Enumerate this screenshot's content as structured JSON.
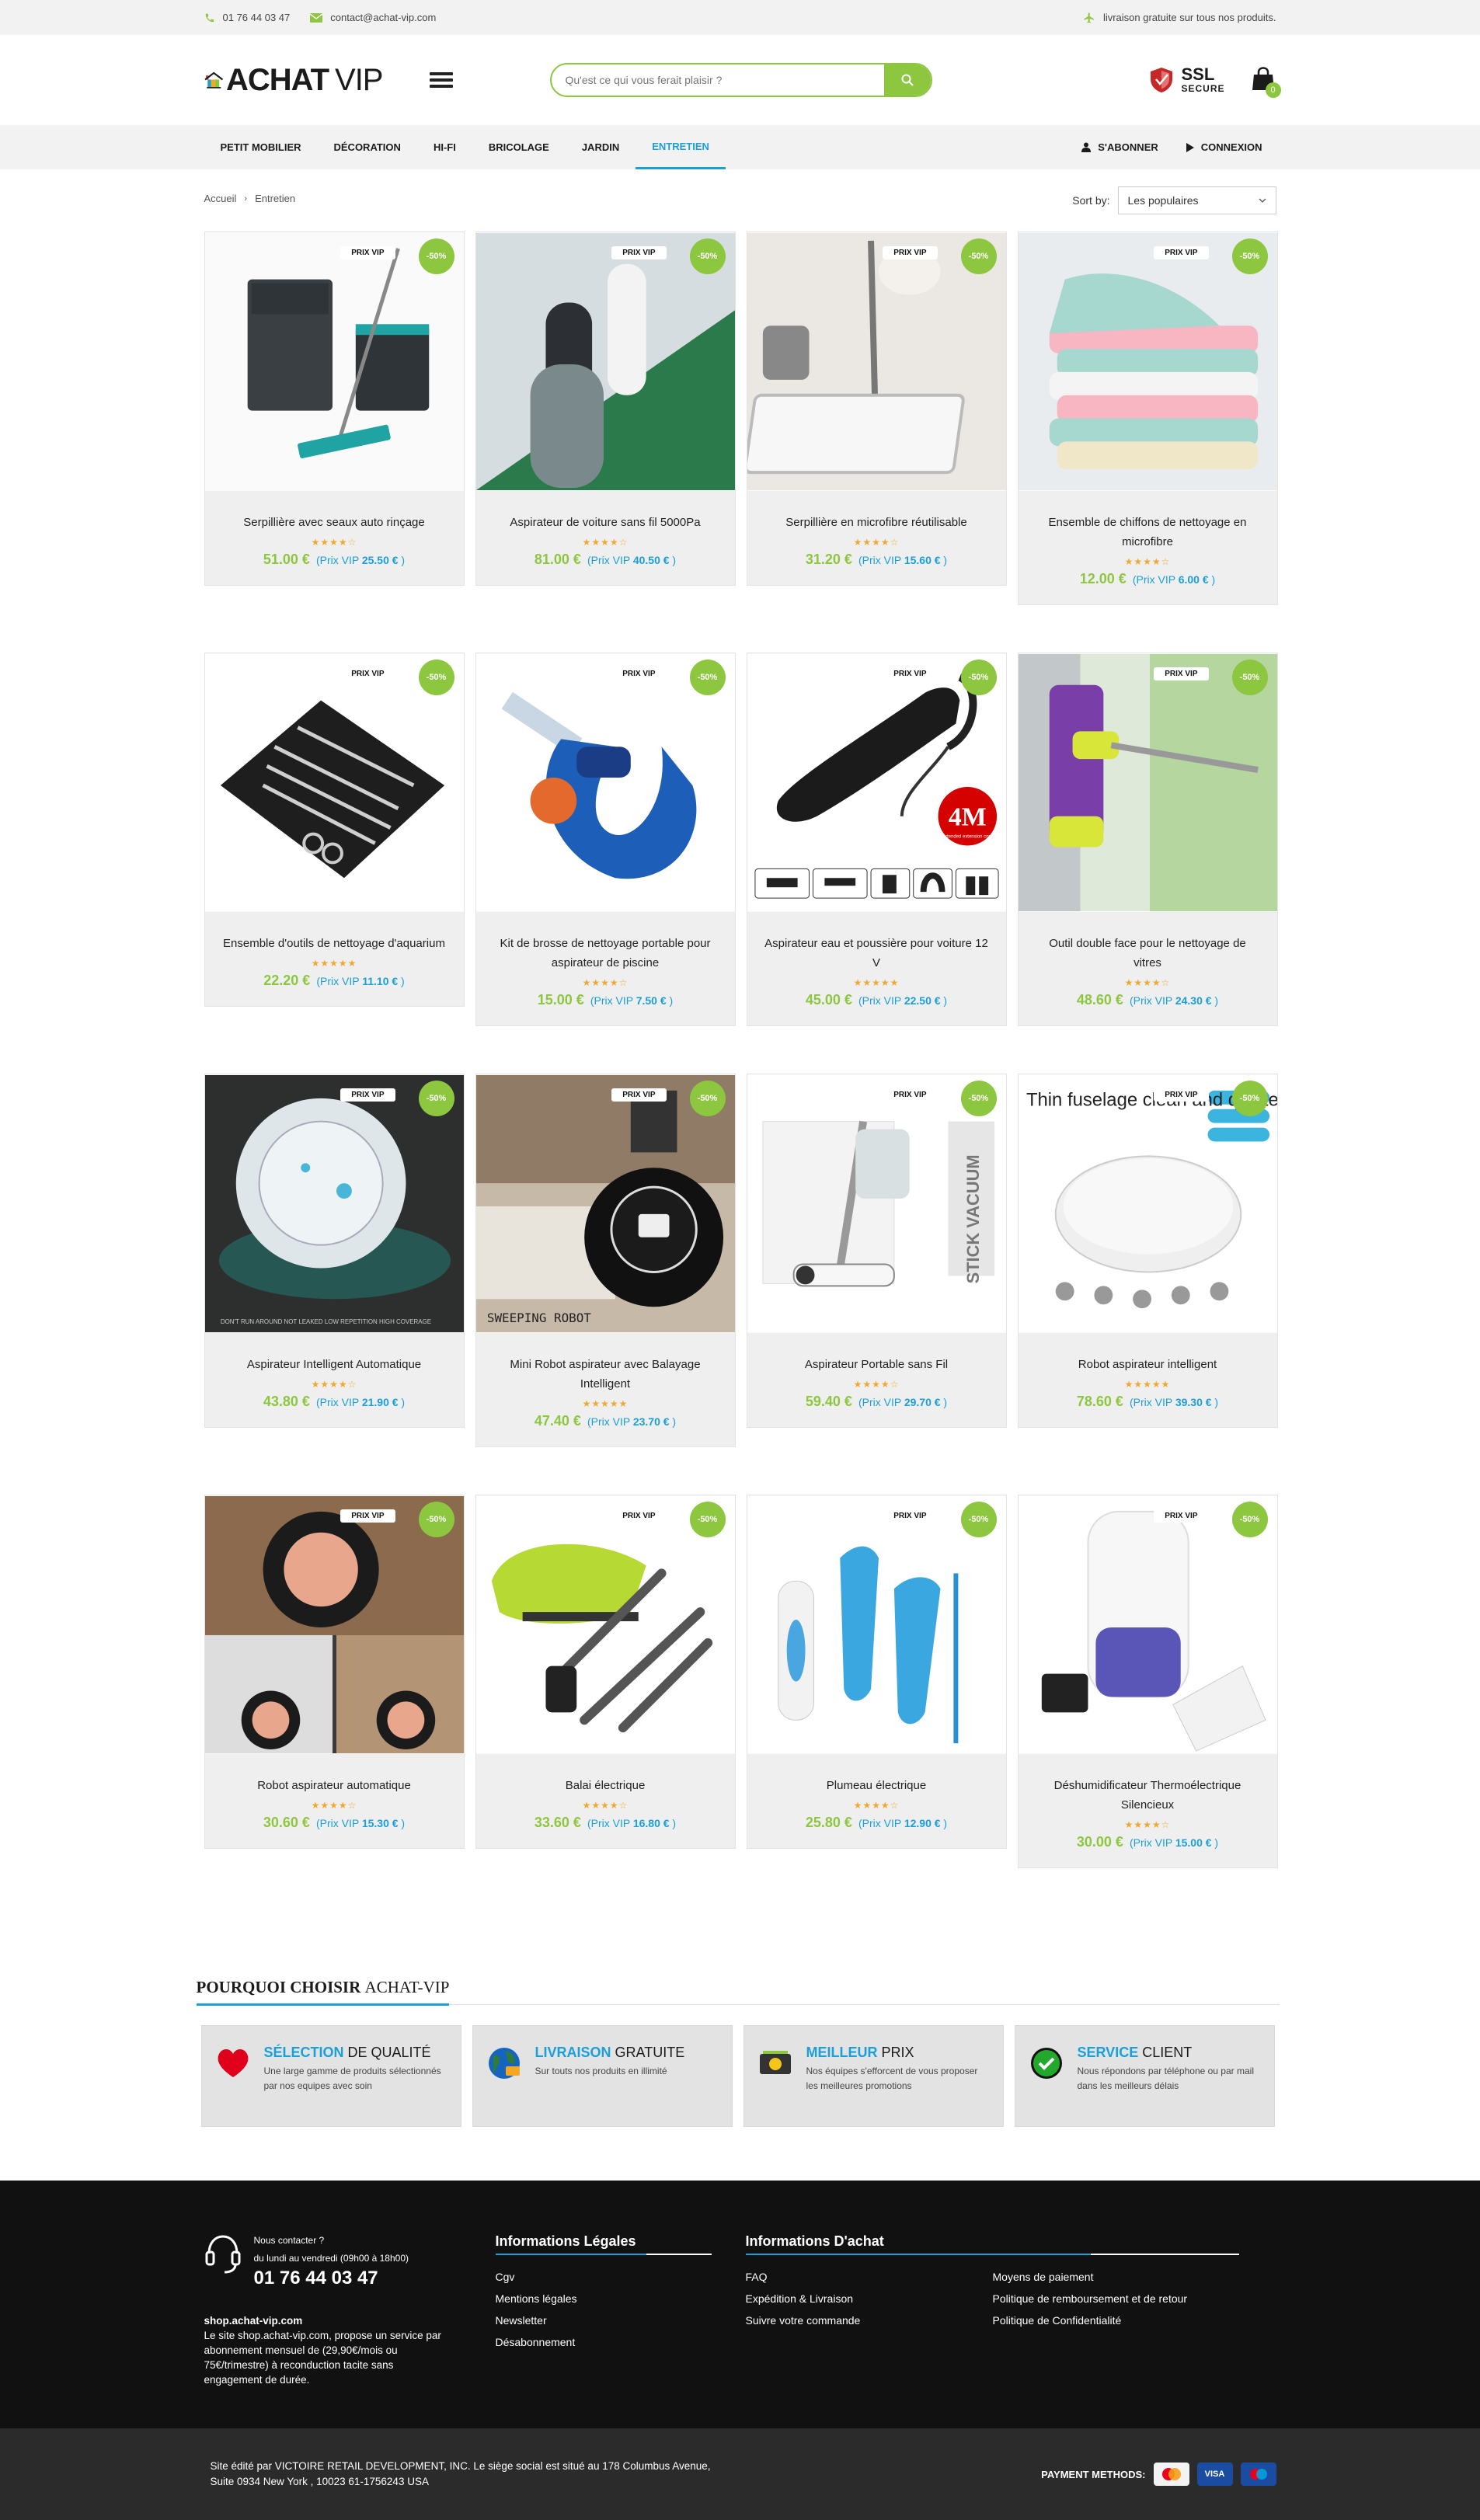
{
  "topbar": {
    "phone": "01 76 44 03 47",
    "email": "contact@achat-vip.com",
    "shipping": "livraison gratuite sur tous nos produits."
  },
  "header": {
    "logo_main": "ACHAT",
    "logo_vip": "VIP",
    "search_placeholder": "Qu'est ce qui vous ferait plaisir ?",
    "ssl_line1": "SSL",
    "ssl_line2": "SECURE",
    "cart_count": "0"
  },
  "nav": {
    "items": [
      "PETIT MOBILIER",
      "DÉCORATION",
      "HI-FI",
      "BRICOLAGE",
      "JARDIN",
      "ENTRETIEN"
    ],
    "active": "ENTRETIEN",
    "subscribe": "S'ABONNER",
    "login": "CONNEXION"
  },
  "breadcrumb": {
    "home": "Accueil",
    "current": "Entretien"
  },
  "sort": {
    "label": "Sort by:",
    "value": "Les populaires"
  },
  "badges": {
    "vip": "PRIX VIP",
    "discount": "-50%"
  },
  "products": [
    {
      "name": "Serpillière avec seaux auto rinçage",
      "price": "51.00 €",
      "vip_label": "(Prix VIP",
      "vip_price": "25.50 €",
      "rating": 4,
      "icon": "mop-bucket"
    },
    {
      "name": "Aspirateur de voiture sans fil 5000Pa",
      "price": "81.00 €",
      "vip_label": "(Prix VIP",
      "vip_price": "40.50 €",
      "rating": 4,
      "icon": "car-vacuum"
    },
    {
      "name": "Serpillière en microfibre réutilisable",
      "price": "31.20 €",
      "vip_label": "(Prix VIP",
      "vip_price": "15.60 €",
      "rating": 4,
      "icon": "spray-mop"
    },
    {
      "name": "Ensemble de chiffons de nettoyage en microfibre",
      "price": "12.00 €",
      "vip_label": "(Prix VIP",
      "vip_price": "6.00 €",
      "rating": 4,
      "icon": "cloths"
    },
    {
      "name": "Ensemble d'outils de nettoyage d'aquarium",
      "price": "22.20 €",
      "vip_label": "(Prix VIP",
      "vip_price": "11.10 €",
      "rating": 4.5,
      "icon": "aquarium-tools"
    },
    {
      "name": "Kit de brosse de nettoyage portable pour aspirateur de piscine",
      "price": "15.00 €",
      "vip_label": "(Prix VIP",
      "vip_price": "7.50 €",
      "rating": 3.5,
      "icon": "pool-brush"
    },
    {
      "name": "Aspirateur eau et poussière pour voiture 12 V",
      "price": "45.00 €",
      "vip_label": "(Prix VIP",
      "vip_price": "22.50 €",
      "rating": 4.5,
      "icon": "handheld-vacuum",
      "overlay_big": "4M",
      "overlay_small": "extended extension cord"
    },
    {
      "name": "Outil double face pour le nettoyage de vitres",
      "price": "48.60 €",
      "vip_label": "(Prix VIP",
      "vip_price": "24.30 €",
      "rating": 4,
      "icon": "window-cleaner"
    },
    {
      "name": "Aspirateur Intelligent Automatique",
      "price": "43.80 €",
      "vip_label": "(Prix VIP",
      "vip_price": "21.90 €",
      "rating": 4,
      "icon": "robot-vacuum-white",
      "overlay_text": "DON'T RUN AROUND   NOT LEAKED   LOW REPETITION   HIGH COVERAGE"
    },
    {
      "name": "Mini Robot aspirateur avec Balayage Intelligent",
      "price": "47.40 €",
      "vip_label": "(Prix VIP",
      "vip_price": "23.70 €",
      "rating": 5,
      "icon": "robot-vacuum-black",
      "overlay_text": "SWEEPING ROBOT"
    },
    {
      "name": "Aspirateur Portable sans Fil",
      "price": "59.40 €",
      "vip_label": "(Prix VIP",
      "vip_price": "29.70 €",
      "rating": 4,
      "icon": "stick-vacuum",
      "overlay_text": "STICK VACUUM"
    },
    {
      "name": "Robot aspirateur intelligent",
      "price": "78.60 €",
      "vip_label": "(Prix VIP",
      "vip_price": "39.30 €",
      "rating": 5,
      "icon": "robot-vacuum-slim",
      "overlay_text": "Thin fuselage clean and quieter"
    },
    {
      "name": "Robot aspirateur automatique",
      "price": "30.60 €",
      "vip_label": "(Prix VIP",
      "vip_price": "15.30 €",
      "rating": 4,
      "icon": "robot-vacuum-pink"
    },
    {
      "name": "Balai électrique",
      "price": "33.60 €",
      "vip_label": "(Prix VIP",
      "vip_price": "16.80 €",
      "rating": 4,
      "icon": "electric-broom"
    },
    {
      "name": "Plumeau électrique",
      "price": "25.80 €",
      "vip_label": "(Prix VIP",
      "vip_price": "12.90 €",
      "rating": 4,
      "icon": "electric-duster"
    },
    {
      "name": "Déshumidificateur Thermoélectrique Silencieux",
      "price": "30.00 €",
      "vip_label": "(Prix VIP",
      "vip_price": "15.00 €",
      "rating": 4,
      "icon": "dehumidifier"
    }
  ],
  "why": {
    "title_bold": "POURQUOI CHOISIR",
    "title_light": "ACHAT-VIP",
    "features": [
      {
        "accent": "SÉLECTION",
        "rest": "DE QUALITÉ",
        "desc": "Une large gamme de produits sélectionnés par nos equipes avec soin",
        "icon": "heart-icon",
        "color": "#e0001b"
      },
      {
        "accent": "LIVRAISON",
        "rest": "GRATUITE",
        "desc": "Sur touts nos produits en illimité",
        "icon": "globe-icon",
        "color": "#2e7d32"
      },
      {
        "accent": "MEILLEUR",
        "rest": "PRIX",
        "desc": "Nos équipes s'efforcent de vous proposer les meilleures promotions",
        "icon": "money-icon",
        "color": "#333333"
      },
      {
        "accent": "SERVICE",
        "rest": "CLIENT",
        "desc": "Nous répondons par téléphone ou par mail dans les meilleurs délais",
        "icon": "check-circle-icon",
        "color": "#22a92c"
      }
    ]
  },
  "footer": {
    "contact_line1": "Nous contacter ?",
    "contact_line2": "du lundi au vendredi (09h00 à 18h00)",
    "phone": "01 76 44 03 47",
    "about_title": "shop.achat-vip.com",
    "about_text": "Le site shop.achat-vip.com, propose un service par abonnement mensuel de (29,90€/mois ou 75€/trimestre) à reconduction tacite sans engagement de durée.",
    "legal_title": "Informations Légales",
    "legal_links": [
      "Cgv",
      "Mentions légales",
      "Newsletter",
      "Désabonnement"
    ],
    "buy_title": "Informations D'achat",
    "buy_links_col1": [
      "FAQ",
      "Expédition & Livraison",
      "Suivre votre commande"
    ],
    "buy_links_col2": [
      "Moyens de paiement",
      "Politique de remboursement et de retour",
      "Politique de Confidentialité"
    ],
    "legal_line1": "Site édité par VICTOIRE RETAIL DEVELOPMENT, INC. Le siège social est situé au 178 Columbus Avenue,",
    "legal_line2": "Suite 0934 New York , 10023 61-1756243 USA",
    "payment_label": "PAYMENT METHODS:",
    "payment_methods": [
      "mastercard",
      "VISA",
      "Maestro"
    ]
  },
  "colors": {
    "accent_green": "#8dc63f",
    "accent_blue": "#1a9fd9",
    "footer_bg": "#111111"
  }
}
